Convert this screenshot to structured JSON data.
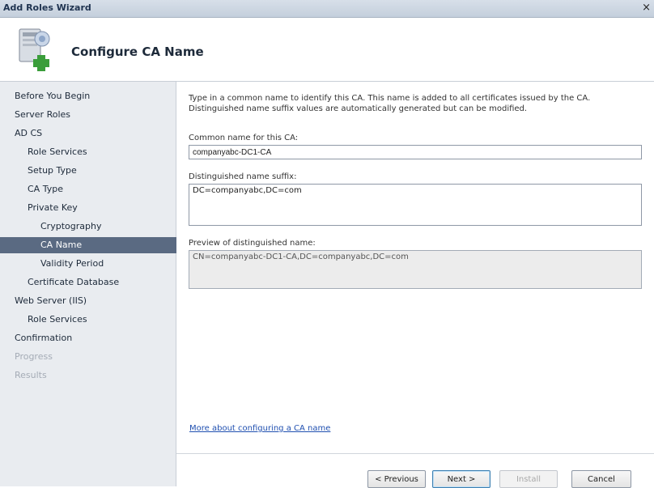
{
  "window": {
    "title": "Add Roles Wizard",
    "close_glyph": "×"
  },
  "header": {
    "title": "Configure CA Name",
    "icon": "server-add-icon"
  },
  "sidebar": {
    "items": [
      {
        "label": "Before You Begin",
        "level": 1,
        "state": "normal"
      },
      {
        "label": "Server Roles",
        "level": 1,
        "state": "normal"
      },
      {
        "label": "AD CS",
        "level": 1,
        "state": "normal"
      },
      {
        "label": "Role Services",
        "level": 2,
        "state": "normal"
      },
      {
        "label": "Setup Type",
        "level": 2,
        "state": "normal"
      },
      {
        "label": "CA Type",
        "level": 2,
        "state": "normal"
      },
      {
        "label": "Private Key",
        "level": 2,
        "state": "normal"
      },
      {
        "label": "Cryptography",
        "level": 3,
        "state": "normal"
      },
      {
        "label": "CA Name",
        "level": 3,
        "state": "active"
      },
      {
        "label": "Validity Period",
        "level": 3,
        "state": "normal"
      },
      {
        "label": "Certificate Database",
        "level": 2,
        "state": "normal"
      },
      {
        "label": "Web Server (IIS)",
        "level": 1,
        "state": "normal"
      },
      {
        "label": "Role Services",
        "level": 2,
        "state": "normal"
      },
      {
        "label": "Confirmation",
        "level": 1,
        "state": "normal"
      },
      {
        "label": "Progress",
        "level": 1,
        "state": "disabled"
      },
      {
        "label": "Results",
        "level": 1,
        "state": "disabled"
      }
    ]
  },
  "main": {
    "description": "Type in a common name to identify this CA. This name is added to all certificates issued by the CA. Distinguished name suffix values are automatically generated but can be modified.",
    "common_name_label": "Common name for this CA:",
    "common_name_value": "companyabc-DC1-CA",
    "dn_suffix_label": "Distinguished name suffix:",
    "dn_suffix_value": "DC=companyabc,DC=com",
    "preview_label": "Preview of distinguished name:",
    "preview_value": "CN=companyabc-DC1-CA,DC=companyabc,DC=com",
    "more_link": "More about configuring a CA name"
  },
  "footer": {
    "previous": "< Previous",
    "next": "Next >",
    "install": "Install",
    "cancel": "Cancel"
  }
}
